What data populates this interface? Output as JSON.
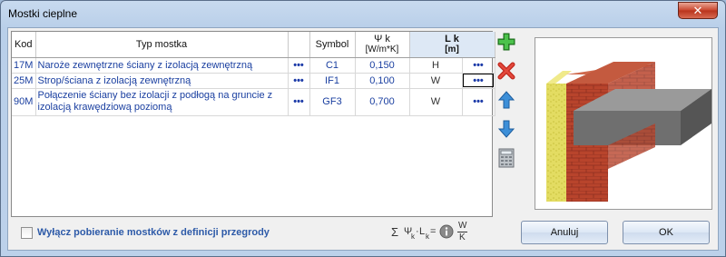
{
  "window": {
    "title": "Mostki cieplne",
    "close_label": "✕"
  },
  "table": {
    "headers": {
      "kod": "Kod",
      "typ": "Typ mostka",
      "symbol": "Symbol",
      "psi": "Ψ k",
      "psi_unit": "[W/m*K]",
      "lk": "L k",
      "lk_unit": "[m]"
    },
    "rows": [
      {
        "kod": "17M",
        "typ": "Naroże zewnętrzne ściany z izolacją zewnętrzną",
        "dots1": "•••",
        "symbol": "C1",
        "psi": "0,150",
        "lk": "H",
        "dots2": "•••"
      },
      {
        "kod": "25M",
        "typ": "Strop/ściana z izolacją zewnętrzną",
        "dots1": "•••",
        "symbol": "IF1",
        "psi": "0,100",
        "lk": "W",
        "dots2": "•••"
      },
      {
        "kod": "90M",
        "typ": "Połączenie ściany bez izolacji z podłogą na gruncie z izolacją krawędziową poziomą",
        "dots1": "•••",
        "symbol": "GF3",
        "psi": "0,700",
        "lk": "W",
        "dots2": "•••"
      }
    ]
  },
  "toolbar": {
    "add": "plus-icon",
    "delete": "x-icon",
    "up": "arrow-up-icon",
    "down": "arrow-down-icon",
    "calc": "calculator-icon"
  },
  "options": {
    "checkbox_label": "Wyłącz pobieranie mostków z definicji przegrody",
    "checked": false
  },
  "formula": {
    "sum": "Σ",
    "psi": "Ψ",
    "sub_k": "k",
    "dot": "·",
    "l": "L",
    "eq": "=",
    "num": "W",
    "den": "K"
  },
  "buttons": {
    "cancel": "Anuluj",
    "ok": "OK"
  },
  "colors": {
    "accent": "#1a3fa0",
    "header_highlight": "#dde8f5"
  }
}
